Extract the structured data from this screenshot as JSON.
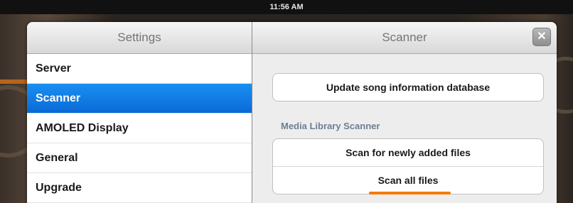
{
  "status_bar": {
    "time": "11:56 AM"
  },
  "settings": {
    "title": "Settings",
    "items": [
      {
        "label": "Server",
        "selected": false
      },
      {
        "label": "Scanner",
        "selected": true
      },
      {
        "label": "AMOLED Display",
        "selected": false
      },
      {
        "label": "General",
        "selected": false
      },
      {
        "label": "Upgrade",
        "selected": false
      }
    ]
  },
  "scanner": {
    "title": "Scanner",
    "close_icon": "✕",
    "update_db_label": "Update song information database",
    "section_header": "Media Library Scanner",
    "scan_new_label": "Scan for newly added files",
    "scan_all_label": "Scan all files"
  },
  "colors": {
    "selected_row": "#0a6ad8",
    "highlight_underline": "#f47b00"
  }
}
